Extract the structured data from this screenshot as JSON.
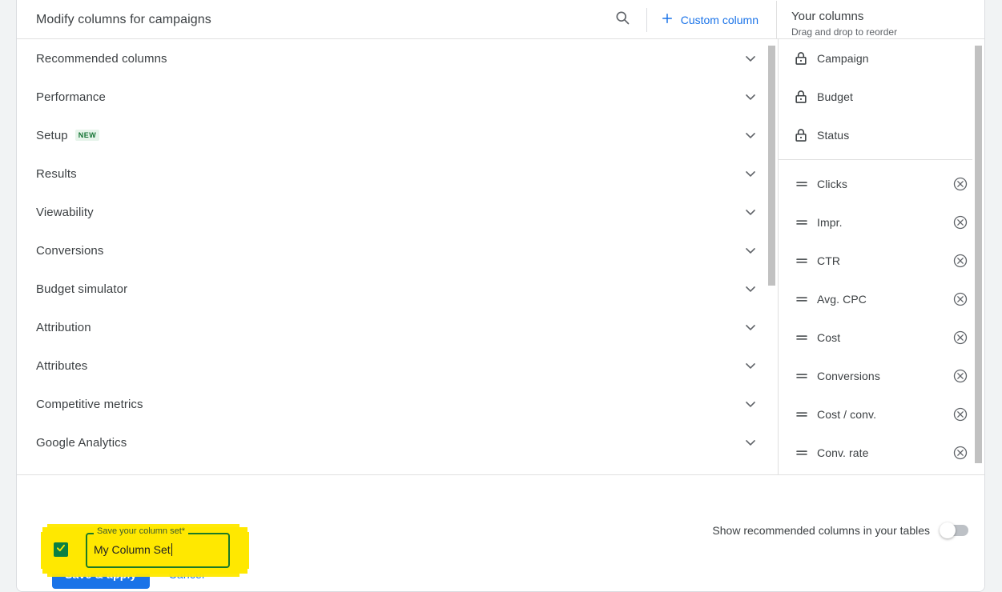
{
  "header": {
    "title": "Modify columns for campaigns",
    "search_icon": "search-icon",
    "custom_column_label": "Custom column",
    "plus_icon": "plus-icon"
  },
  "right_panel": {
    "title": "Your columns",
    "subtitle": "Drag and drop to reorder",
    "locked_items": [
      {
        "label": "Campaign",
        "icon": "lock-icon"
      },
      {
        "label": "Budget",
        "icon": "lock-icon"
      },
      {
        "label": "Status",
        "icon": "lock-icon"
      }
    ],
    "draggable_items": [
      {
        "label": "Clicks",
        "icon": "drag-handle-icon",
        "remove_icon": "remove-circle-icon"
      },
      {
        "label": "Impr.",
        "icon": "drag-handle-icon",
        "remove_icon": "remove-circle-icon"
      },
      {
        "label": "CTR",
        "icon": "drag-handle-icon",
        "remove_icon": "remove-circle-icon"
      },
      {
        "label": "Avg. CPC",
        "icon": "drag-handle-icon",
        "remove_icon": "remove-circle-icon"
      },
      {
        "label": "Cost",
        "icon": "drag-handle-icon",
        "remove_icon": "remove-circle-icon"
      },
      {
        "label": "Conversions",
        "icon": "drag-handle-icon",
        "remove_icon": "remove-circle-icon"
      },
      {
        "label": "Cost / conv.",
        "icon": "drag-handle-icon",
        "remove_icon": "remove-circle-icon"
      },
      {
        "label": "Conv. rate",
        "icon": "drag-handle-icon",
        "remove_icon": "remove-circle-icon"
      }
    ]
  },
  "categories": [
    {
      "label": "Recommended columns",
      "badge": "",
      "chevron": "chevron-down-icon"
    },
    {
      "label": "Performance",
      "badge": "",
      "chevron": "chevron-down-icon"
    },
    {
      "label": "Setup",
      "badge": "NEW",
      "chevron": "chevron-down-icon"
    },
    {
      "label": "Results",
      "badge": "",
      "chevron": "chevron-down-icon"
    },
    {
      "label": "Viewability",
      "badge": "",
      "chevron": "chevron-down-icon"
    },
    {
      "label": "Conversions",
      "badge": "",
      "chevron": "chevron-down-icon"
    },
    {
      "label": "Budget simulator",
      "badge": "",
      "chevron": "chevron-down-icon"
    },
    {
      "label": "Attribution",
      "badge": "",
      "chevron": "chevron-down-icon"
    },
    {
      "label": "Attributes",
      "badge": "",
      "chevron": "chevron-down-icon"
    },
    {
      "label": "Competitive metrics",
      "badge": "",
      "chevron": "chevron-down-icon"
    },
    {
      "label": "Google Analytics",
      "badge": "",
      "chevron": "chevron-down-icon"
    }
  ],
  "footer": {
    "save_set_label": "Save your column set*",
    "save_set_value": "My Column Set",
    "save_set_placeholder": "Save your column set",
    "checkbox_checked": true,
    "toggle_label": "Show recommended columns in your tables",
    "toggle_on": false,
    "primary_button": "Save & apply",
    "cancel_button": "Cancel"
  },
  "colors": {
    "accent_blue": "#1a73e8",
    "highlight_yellow": "#ffe800",
    "checkbox_green": "#0b8043",
    "field_border_green": "#1b7a26",
    "badge_green_bg": "#e6f4ea",
    "badge_green_fg": "#137333"
  }
}
